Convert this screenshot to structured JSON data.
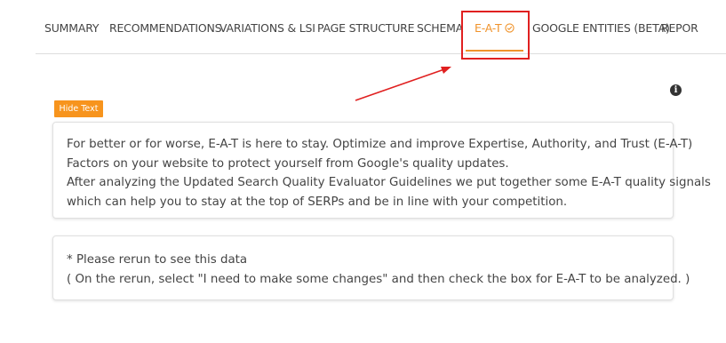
{
  "tabs": [
    {
      "label": "SUMMARY"
    },
    {
      "label": "RECOMMENDATIONS"
    },
    {
      "label": "VARIATIONS & LSI"
    },
    {
      "label": "PAGE STRUCTURE"
    },
    {
      "label": "SCHEMA"
    },
    {
      "label": "E-A-T",
      "active": true,
      "icon": "check-circle-icon"
    },
    {
      "label": "GOOGLE ENTITIES (BETA)"
    },
    {
      "label": "REPOR"
    }
  ],
  "accent_color": "#f0932b",
  "annotation_color": "#e02020",
  "hide_button": {
    "label": "Hide Text"
  },
  "info_icon": "info-icon",
  "description": {
    "line1": "For better or for worse, E-A-T is here to stay. Optimize and improve Expertise, Authority, and Trust (E-A-T)",
    "line2": "Factors on your website to protect yourself from Google's quality updates.",
    "line3": "After analyzing the Updated Search Quality Evaluator Guidelines we put together some E-A-T quality signals",
    "line4": "which can help you to stay at the top of SERPs and be in line with your competition."
  },
  "notice": {
    "line1": "* Please rerun to see this data",
    "line2": "( On the rerun, select \"I need to make some changes\" and then check the box for E-A-T to be analyzed. )"
  }
}
